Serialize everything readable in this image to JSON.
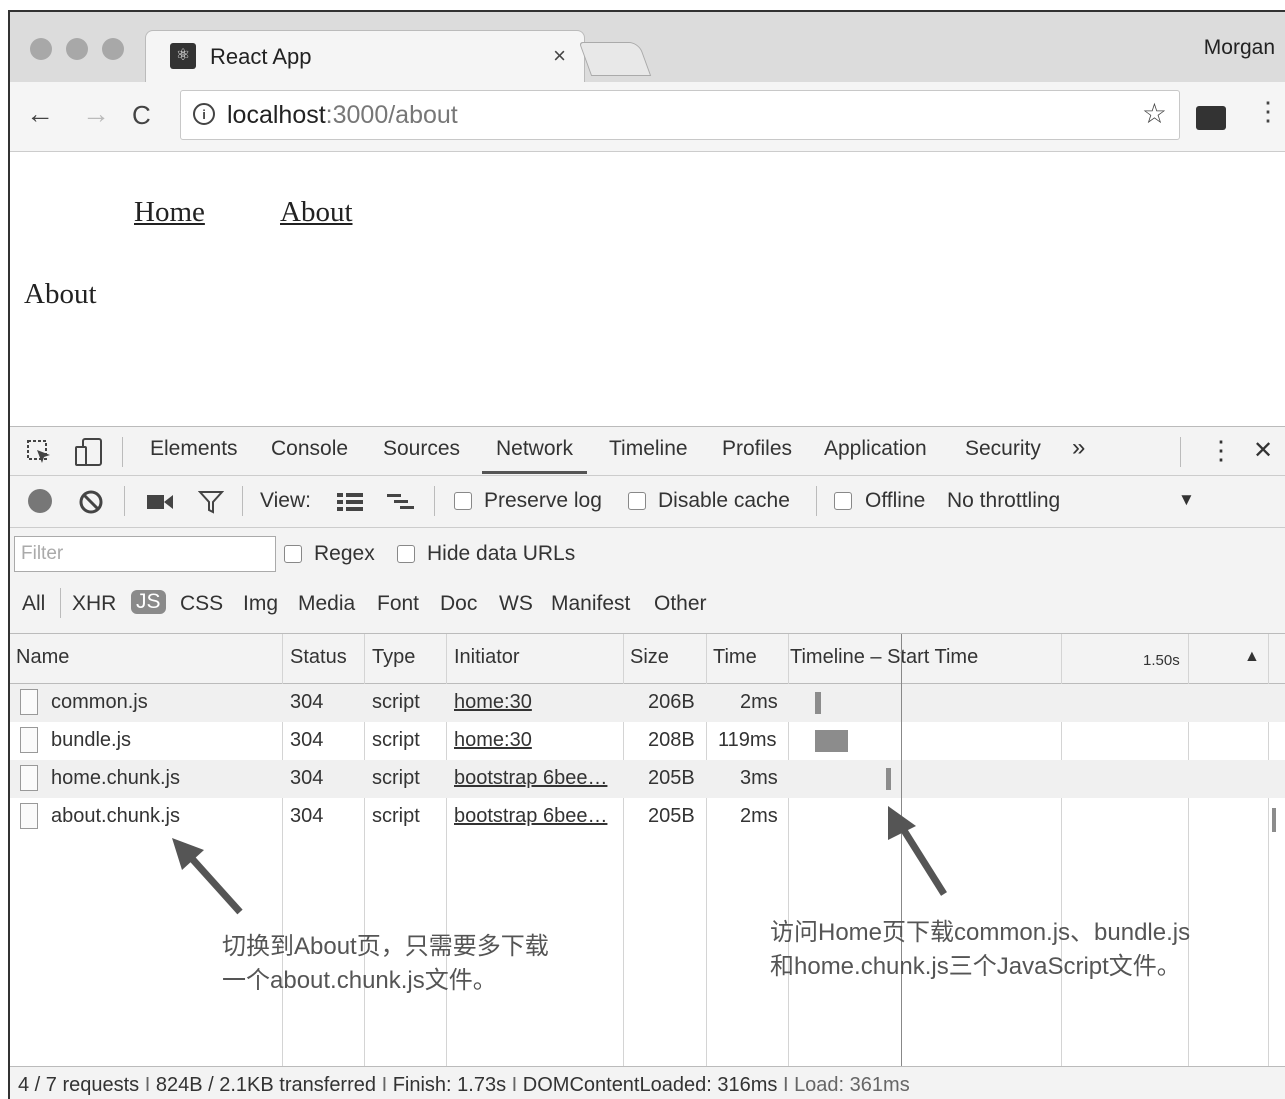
{
  "browser": {
    "tab_title": "React App",
    "tab_close": "×",
    "profile_name": "Morgan",
    "url_host": "localhost",
    "url_path": ":3000/about",
    "back_glyph": "←",
    "forward_glyph": "→",
    "reload_glyph": "C",
    "star_glyph": "☆",
    "menu_glyph": "⋮",
    "info_glyph": "i"
  },
  "page": {
    "nav_links": [
      "Home",
      "About"
    ],
    "heading": "About"
  },
  "devtools": {
    "tabs": [
      "Elements",
      "Console",
      "Sources",
      "Network",
      "Timeline",
      "Profiles",
      "Application",
      "Security"
    ],
    "active_tab": "Network",
    "more_tabs": "»",
    "close_glyph": "✕",
    "menu_glyph": "⋮",
    "network_toolbar": {
      "view_label": "View:",
      "preserve_log": "Preserve log",
      "disable_cache": "Disable cache",
      "offline": "Offline",
      "throttling": "No throttling",
      "dropdown_glyph": "▼"
    },
    "filter": {
      "placeholder": "Filter",
      "regex": "Regex",
      "hide_data_urls": "Hide data URLs",
      "types": [
        "All",
        "XHR",
        "JS",
        "CSS",
        "Img",
        "Media",
        "Font",
        "Doc",
        "WS",
        "Manifest",
        "Other"
      ],
      "active_type": "JS"
    },
    "table": {
      "headers": {
        "name": "Name",
        "status": "Status",
        "type": "Type",
        "initiator": "Initiator",
        "size": "Size",
        "time": "Time",
        "timeline": "Timeline – Start Time",
        "timeline_tick": "1.50s",
        "sort_glyph": "▲"
      },
      "rows": [
        {
          "name": "common.js",
          "status": "304",
          "type": "script",
          "initiator": "home:30",
          "size": "206B",
          "time": "2ms"
        },
        {
          "name": "bundle.js",
          "status": "304",
          "type": "script",
          "initiator": "home:30",
          "size": "208B",
          "time": "119ms"
        },
        {
          "name": "home.chunk.js",
          "status": "304",
          "type": "script",
          "initiator": "bootstrap 6bee…",
          "size": "205B",
          "time": "3ms"
        },
        {
          "name": "about.chunk.js",
          "status": "304",
          "type": "script",
          "initiator": "bootstrap 6bee…",
          "size": "205B",
          "time": "2ms"
        }
      ]
    },
    "annotations": {
      "left_line1": "切换到About页，只需要多下载",
      "left_line2": "一个about.chunk.js文件。",
      "right_line1": "访问Home页下载common.js、bundle.js",
      "right_line2": "和home.chunk.js三个JavaScript文件。"
    },
    "status_bar": {
      "requests": "4 / 7 requests",
      "sep1": "I",
      "transferred": "824B / 2.1KB transferred",
      "sep2": "I",
      "finish": "Finish: 1.73s",
      "sep3": "I",
      "dom_content_loaded": "DOMContentLoaded: 316ms",
      "sep4": "I",
      "load": "Load: 361ms"
    }
  }
}
